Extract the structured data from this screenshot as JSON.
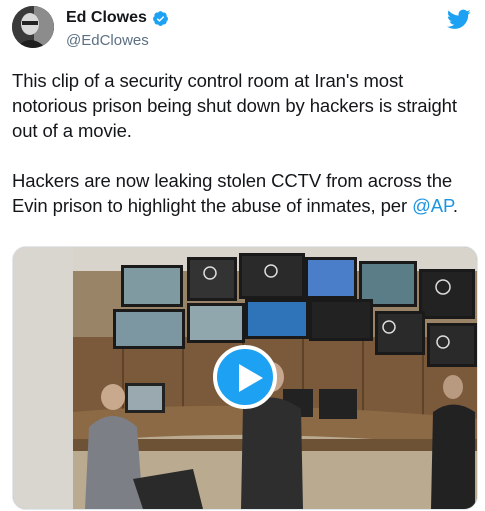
{
  "author": {
    "name": "Ed Clowes",
    "handle": "@EdClowes",
    "verified_icon": "verified-badge-icon",
    "avatar_icon": "profile-photo"
  },
  "brand": {
    "icon": "twitter-bird-icon",
    "color": "#1da1f2"
  },
  "tweet": {
    "paragraph1": "This clip of a security control room at Iran's most notorious prison being shut down by hackers is straight out of a movie.",
    "paragraph2_text": "Hackers are now leaking stolen CCTV from across the Evin prison to highlight the abuse of inmates, per ",
    "mention": "@AP",
    "paragraph2_end": "."
  },
  "media": {
    "type": "video",
    "play_icon": "play-icon",
    "description_colors": {
      "play_button": "#1da1f2"
    }
  }
}
